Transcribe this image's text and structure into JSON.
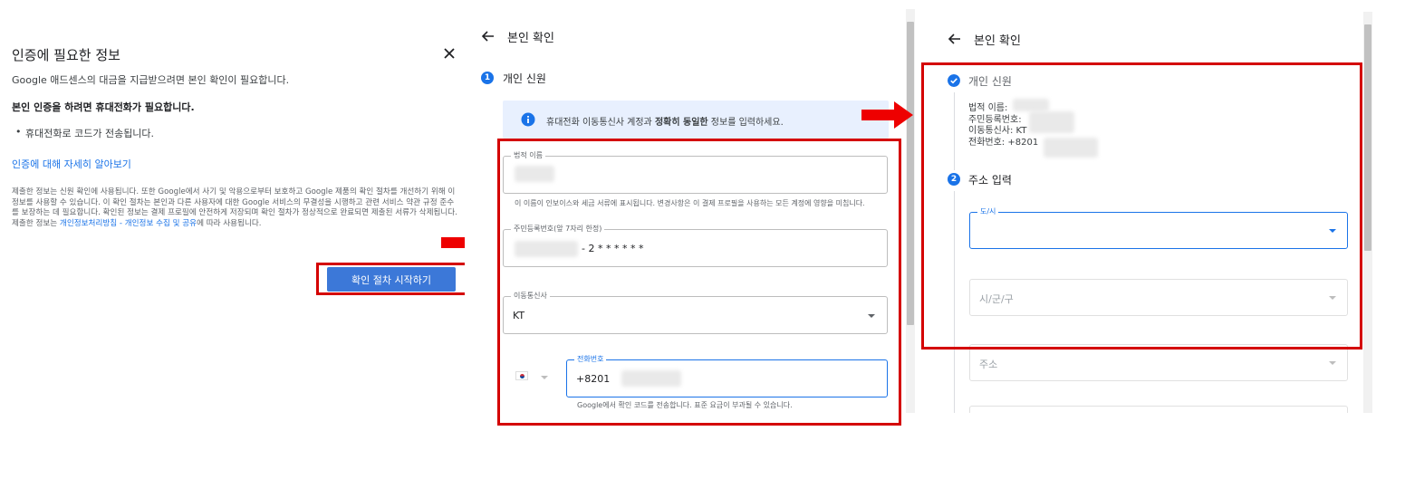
{
  "panel1": {
    "title": "인증에 필요한 정보",
    "description": "Google 애드센스의 대금을 지급받으려면 본인 확인이 필요합니다.",
    "bold_notice": "본인 인증을 하려면 휴대전화가 필요합니다.",
    "bullet": "휴대전화로 코드가 전송됩니다.",
    "learn_more_link": "인증에 대해 자세히 알아보기",
    "fine_print": "제출한 정보는 신원 확인에 사용됩니다. 또한 Google에서 사기 및 악용으로부터 보호하고 Google 제품의 확인 절차를 개선하기 위해 이 정보를 사용할 수 있습니다. 이 확인 절차는 본인과 다른 사용자에 대한 Google 서비스의 무결성을 시행하고 관련 서비스 약관 규정 준수를 보장하는 데 필요합니다. 확인된 정보는 결제 프로필에 안전하게 저장되며 확인 절차가 정상적으로 완료되면 제출된 서류가 삭제됩니다. 제출한 정보는 ",
    "fine_print_link": "개인정보처리방침 - 개인정보 수집 및 공유",
    "fine_print_end": "에 따라 사용됩니다.",
    "start_button": "확인 절차 시작하기"
  },
  "panel2": {
    "header": "본인 확인",
    "step_number": "1",
    "step_label": "개인 신원",
    "info_text_pre": "휴대전화 이동통신사 계정과 ",
    "info_text_bold": "정확히 동일한",
    "info_text_post": " 정보를 입력하세요.",
    "legal_name_label": "법적 이름",
    "legal_name_helper": "이 이름이 인보이스와 세금 서류에 표시됩니다. 변경사항은 이 결제 프로필을 사용하는 모든 계정에 영향을 미칩니다.",
    "rrn_label": "주민등록번호(앞 7자리 한정)",
    "rrn_value": "- 2 * * * * * *",
    "carrier_label": "이동통신사",
    "carrier_value": "KT",
    "phone_label": "전화번호",
    "phone_value": "+8201",
    "phone_helper": "Google에서 확인 코드를 전송합니다. 표준 요금이 부과될 수 있습니다."
  },
  "panel3": {
    "header": "본인 확인",
    "step1_label": "개인 신원",
    "summary_name": "법적 이름:",
    "summary_rrn": "주민등록번호:",
    "summary_carrier": "이동통신사:  KT",
    "summary_phone": "전화번호:  +8201",
    "step2_number": "2",
    "step2_label": "주소 입력",
    "city_label": "도/시",
    "district_placeholder": "시/군/구",
    "address_placeholder": "주소"
  },
  "colors": {
    "accent": "#1a73e8",
    "highlight_red": "#d40000",
    "button_blue": "#3c78d8",
    "info_bg": "#e8f0fe"
  }
}
